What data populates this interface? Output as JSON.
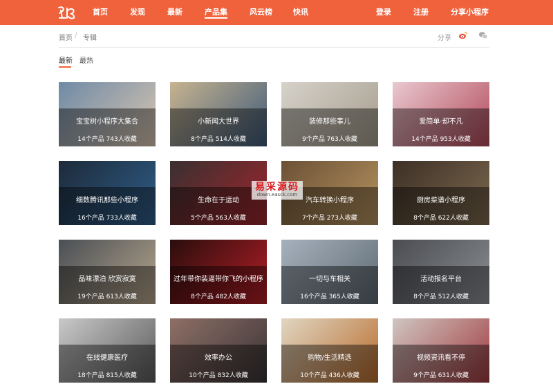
{
  "nav": {
    "items": [
      "首页",
      "发现",
      "最新",
      "产品集",
      "风云榜",
      "快讯"
    ],
    "active": "产品集",
    "login": "登录",
    "register": "注册",
    "share_app": "分享小程序"
  },
  "breadcrumb": {
    "home": "首页",
    "separator": "/",
    "current": "专辑"
  },
  "share": {
    "label": "分享",
    "icons": [
      "weibo-icon",
      "wechat-icon"
    ]
  },
  "sort_tabs": {
    "items": [
      "最新",
      "最热"
    ],
    "active": "最新"
  },
  "watermark": {
    "main": "易采源码",
    "sub": "down.easck.com"
  },
  "cards": [
    {
      "title": "宝宝树小程序大集合",
      "meta": "14个产品 743人收藏",
      "colors": [
        "#6f8aa6",
        "#d9c6b0"
      ]
    },
    {
      "title": "小新闻大世界",
      "meta": "8个产品 514人收藏",
      "colors": [
        "#c7b38f",
        "#3d5a7a"
      ]
    },
    {
      "title": "装修那些事儿",
      "meta": "9个产品 763人收藏",
      "colors": [
        "#d6d2ca",
        "#a59c8c"
      ]
    },
    {
      "title": "爱简单·却不凡",
      "meta": "14个产品 953人收藏",
      "colors": [
        "#e9c8cf",
        "#b24a5a"
      ]
    },
    {
      "title": "细数腾讯那些小程序",
      "meta": "16个产品 733人收藏",
      "colors": [
        "#1d2a3a",
        "#2f5f8a"
      ]
    },
    {
      "title": "生命在于运动",
      "meta": "5个产品 563人收藏",
      "colors": [
        "#3a3030",
        "#a0252d"
      ]
    },
    {
      "title": "汽车转换小程序",
      "meta": "7个产品 273人收藏",
      "colors": [
        "#6b5136",
        "#b7935f"
      ]
    },
    {
      "title": "厨房菜谱小程序",
      "meta": "8个产品 622人收藏",
      "colors": [
        "#3c2f25",
        "#7d6a4f"
      ]
    },
    {
      "title": "品味漂泊 欣赏寂寞",
      "meta": "19个产品 613人收藏",
      "colors": [
        "#4a4f55",
        "#b7a68c"
      ]
    },
    {
      "title": "过年带你装逼带你飞的小程序",
      "meta": "8个产品 482人收藏",
      "colors": [
        "#2a0d0d",
        "#b51f26"
      ]
    },
    {
      "title": "一切与车相关",
      "meta": "16个产品 365人收藏",
      "colors": [
        "#a6b1bd",
        "#5e6a72"
      ]
    },
    {
      "title": "活动报名平台",
      "meta": "8个产品 512人收藏",
      "colors": [
        "#4a4c50",
        "#8c8f94"
      ]
    },
    {
      "title": "在线健康医疗",
      "meta": "18个产品 815人收藏",
      "colors": [
        "#c9c9c9",
        "#5a5a5a"
      ]
    },
    {
      "title": "效率办公",
      "meta": "10个产品 832人收藏",
      "colors": [
        "#8e6f66",
        "#3a3436"
      ]
    },
    {
      "title": "购物/生活精选",
      "meta": "10个产品 436人收藏",
      "colors": [
        "#e0d6c2",
        "#b86b2c"
      ]
    },
    {
      "title": "视频资讯看不停",
      "meta": "9个产品 631人收藏",
      "colors": [
        "#cfc6c1",
        "#a13a3f"
      ]
    }
  ]
}
